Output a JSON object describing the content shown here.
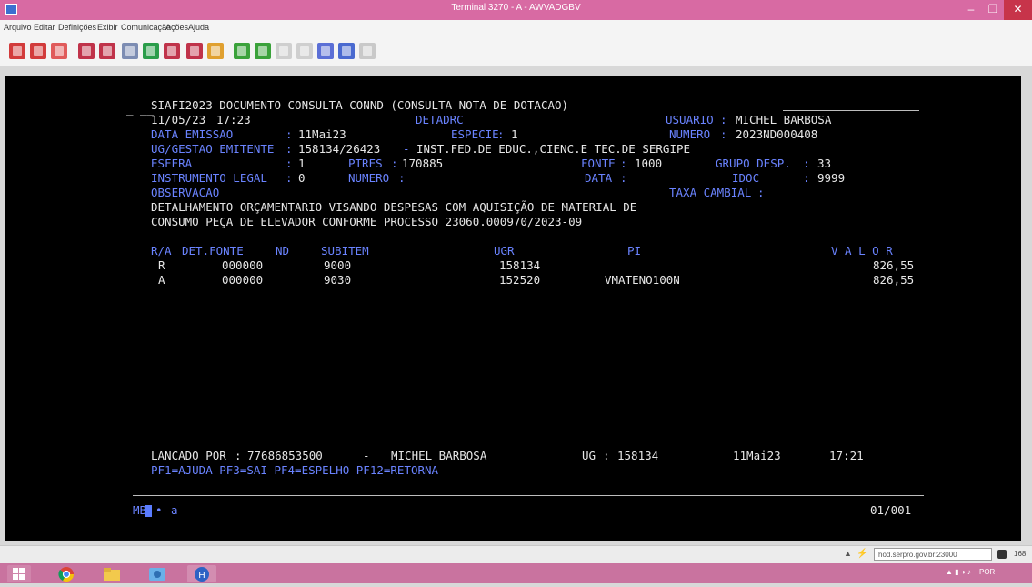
{
  "window": {
    "title": "Terminal 3270 - A - AWVADGBV"
  },
  "menu": [
    "Arquivo",
    "Editar",
    "Definições",
    "Exibir",
    "Comunicação",
    "Ações",
    "Ajuda"
  ],
  "colors": {
    "titlebar": "#d86aa3",
    "terminal_bg": "#000000",
    "field_label": "#6a83ff",
    "field_value": "#e6e6e6",
    "taskbar": "#c9739f"
  },
  "toolbar_icons": [
    "copy-icon",
    "paste-icon",
    "print-icon",
    "send-icon",
    "receive-icon",
    "doc-icon",
    "green-doc-icon",
    "macro-icon",
    "keyboard-icon",
    "color-icon",
    "transfer-icon",
    "transfer2-icon",
    "disabled-icon",
    "disabled2-icon",
    "edit-icon",
    "upload-icon",
    "refresh-icon"
  ],
  "terminal": {
    "header_title": "SIAFI2023-DOCUMENTO-CONSULTA-CONND (CONSULTA NOTA DE DOTACAO)",
    "date": "11/05/23",
    "time": "17:23",
    "screen_code": "DETADRC",
    "usuario_label": "USUARIO",
    "usuario": "MICHEL BARBOSA",
    "data_emissao_label": "DATA EMISSAO",
    "data_emissao": "11Mai23",
    "especie_label": "ESPECIE",
    "especie": "1",
    "numero_label": "NUMERO",
    "numero": "2023ND000408",
    "ug_gestao_label": "UG/GESTAO EMITENTE",
    "ug_gestao": "158134/26423",
    "ug_nome": "INST.FED.DE EDUC.,CIENC.E TEC.DE SERGIPE",
    "esfera_label": "ESFERA",
    "esfera": "1",
    "ptres_label": "PTRES",
    "ptres": "170885",
    "fonte_label": "FONTE",
    "fonte": "1000",
    "grupo_desp_label": "GRUPO DESP.",
    "grupo_desp": "33",
    "instrumento_label": "INSTRUMENTO LEGAL",
    "instrumento": "0",
    "numero2_label": "NUMERO",
    "data2_label": "DATA",
    "idoc_label": "IDOC",
    "idoc": "9999",
    "observacao_label": "OBSERVACAO",
    "taxa_label": "TAXA CAMBIAL",
    "obs_line1": "DETALHAMENTO ORÇAMENTARIO VISANDO DESPESAS COM AQUISIÇÃO DE MATERIAL DE",
    "obs_line2": "CONSUMO PEÇA DE ELEVADOR CONFORME PROCESSO 23060.000970/2023-09",
    "table_headers": {
      "ra": "R/A",
      "det_fonte": "DET.FONTE",
      "nd": "ND",
      "subitem": "SUBITEM",
      "ugr": "UGR",
      "pi": "PI",
      "valor": "V A L O R"
    },
    "rows": [
      {
        "ra": "R",
        "det_fonte": "000000",
        "nd": "9000",
        "subitem": "",
        "ugr": "158134",
        "pi": "",
        "valor": "826,55"
      },
      {
        "ra": "A",
        "det_fonte": "000000",
        "nd": "9030",
        "subitem": "",
        "ugr": "152520",
        "pi": "VMATENO100N",
        "valor": "826,55"
      }
    ],
    "lancado_label": "LANCADO POR",
    "lancado_cpf": "77686853500",
    "lancado_nome": "MICHEL BARBOSA",
    "ug_label": "UG",
    "ug_lanc": "158134",
    "lanc_date": "11Mai23",
    "lanc_time": "17:21",
    "pf_keys": "PF1=AJUDA PF3=SAI PF4=ESPELHO PF12=RETORNA",
    "cmd_prefix": "MB",
    "cmd_after": "a",
    "page_counter": "01/001"
  },
  "status": {
    "url": "hod.serpro.gov.br:23000",
    "session_num": "168"
  },
  "taskbar": {
    "icons": [
      "windows-start-icon",
      "chrome-icon",
      "file-explorer-icon",
      "media-icon",
      "hod-app-icon"
    ],
    "tray_lang": "POR"
  }
}
